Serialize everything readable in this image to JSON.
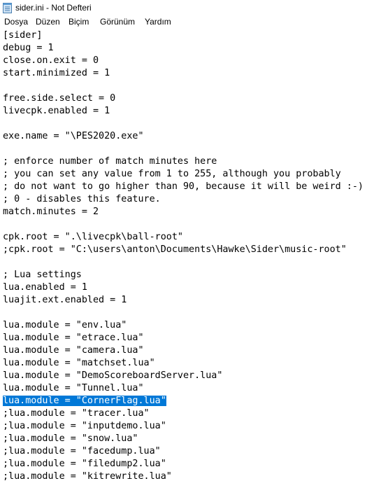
{
  "window": {
    "title": "sider.ini - Not Defteri"
  },
  "menu": [
    "Dosya",
    "Düzen",
    "Biçim",
    "Görünüm",
    "Yardım"
  ],
  "editor": {
    "selected_line_index": 29,
    "lines": [
      "[sider]",
      "debug = 1",
      "close.on.exit = 0",
      "start.minimized = 1",
      "",
      "free.side.select = 0",
      "livecpk.enabled = 1",
      "",
      "exe.name = \"\\PES2020.exe\"",
      "",
      "; enforce number of match minutes here",
      "; you can set any value from 1 to 255, although you probably",
      "; do not want to go higher than 90, because it will be weird :-)",
      "; 0 - disables this feature.",
      "match.minutes = 2",
      "",
      "cpk.root = \".\\livecpk\\ball-root\"",
      ";cpk.root = \"C:\\users\\anton\\Documents\\Hawke\\Sider\\music-root\"",
      "",
      "; Lua settings",
      "lua.enabled = 1",
      "luajit.ext.enabled = 1",
      "",
      "lua.module = \"env.lua\"",
      "lua.module = \"etrace.lua\"",
      "lua.module = \"camera.lua\"",
      "lua.module = \"matchset.lua\"",
      "lua.module = \"DemoScoreboardServer.lua\"",
      "lua.module = \"Tunnel.lua\"",
      "lua.module = \"CornerFlag.lua\"",
      ";lua.module = \"tracer.lua\"",
      ";lua.module = \"inputdemo.lua\"",
      ";lua.module = \"snow.lua\"",
      ";lua.module = \"facedump.lua\"",
      ";lua.module = \"filedump2.lua\"",
      ";lua.module = \"kitrewrite.lua\""
    ]
  }
}
